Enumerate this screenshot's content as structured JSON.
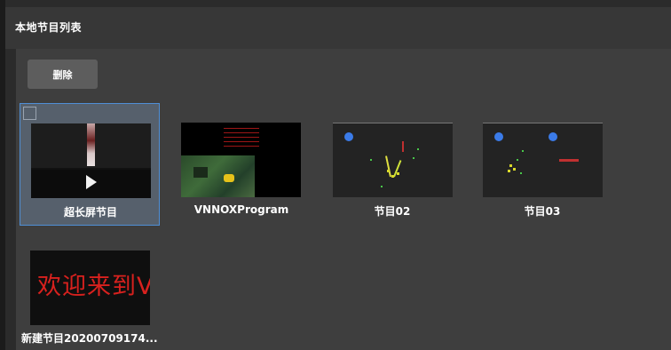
{
  "header": {
    "title": "本地节目列表"
  },
  "toolbar": {
    "delete_label": "删除"
  },
  "programs": [
    {
      "name": "超长屏节目",
      "selected": true
    },
    {
      "name": "VNNOXProgram",
      "selected": false
    },
    {
      "name": "节目02",
      "selected": false
    },
    {
      "name": "节目03",
      "selected": false
    },
    {
      "name": "新建节目20200709174...",
      "selected": false,
      "thumb_text": "欢迎来到V"
    }
  ],
  "colors": {
    "selection_border": "#4f8fd6",
    "accent_red": "#d8211e",
    "ball_blue": "#3b7be8"
  }
}
